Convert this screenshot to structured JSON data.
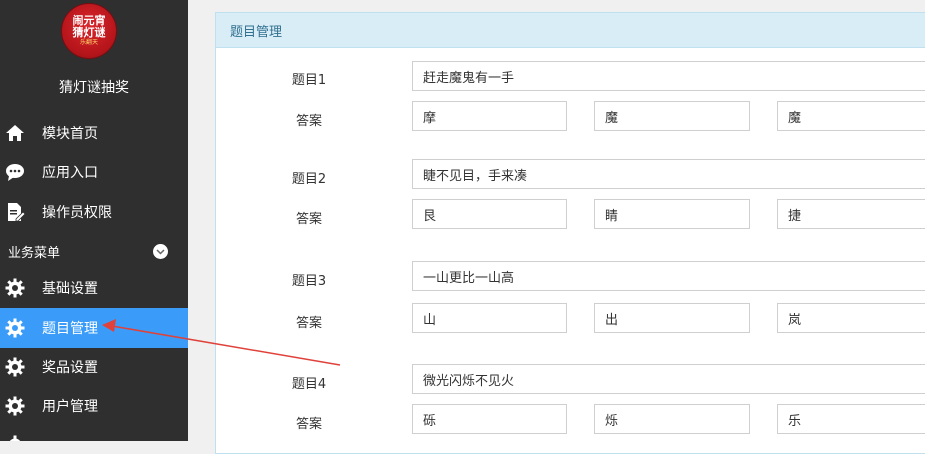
{
  "sidebar": {
    "logo": {
      "line1": "闹元宵",
      "line2": "猜灯谜",
      "line3": "乐翻天"
    },
    "title": "猜灯谜抽奖",
    "items": [
      {
        "label": "模块首页",
        "icon": "home-icon"
      },
      {
        "label": "应用入口",
        "icon": "chat-bubble-icon"
      },
      {
        "label": "操作员权限",
        "icon": "document-edit-icon"
      }
    ],
    "section": {
      "label": "业务菜单",
      "icon": "chevron-down-icon"
    },
    "biz_items": [
      {
        "label": "基础设置",
        "icon": "gear-icon"
      },
      {
        "label": "题目管理",
        "icon": "gear-icon",
        "active": true
      },
      {
        "label": "奖品设置",
        "icon": "gear-icon"
      },
      {
        "label": "用户管理",
        "icon": "gear-icon"
      }
    ],
    "active_color": "#3a9cf8"
  },
  "panel": {
    "title": "题目管理",
    "answer_label": "答案",
    "questions": [
      {
        "label": "题目1",
        "text": "赶走魔鬼有一手",
        "answers": [
          "摩",
          "魔",
          "魔"
        ]
      },
      {
        "label": "题目2",
        "text": "睫不见目，手来凑",
        "answers": [
          "艮",
          "睛",
          "捷"
        ]
      },
      {
        "label": "题目3",
        "text": "一山更比一山高",
        "answers": [
          "山",
          "出",
          "岚"
        ]
      },
      {
        "label": "题目4",
        "text": "微光闪烁不见火",
        "answers": [
          "砾",
          "烁",
          "乐"
        ]
      }
    ]
  },
  "annotation": {
    "color": "#e0413a"
  }
}
